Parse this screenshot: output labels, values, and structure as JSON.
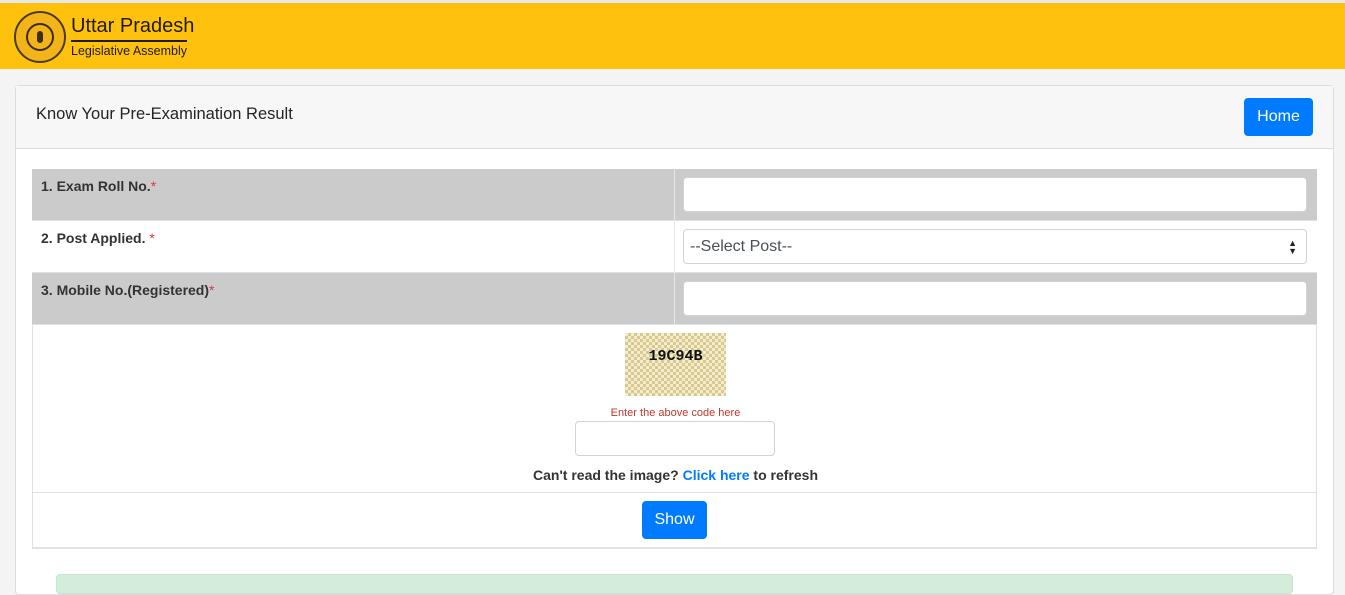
{
  "header": {
    "brand_title": "Uttar Pradesh",
    "brand_subtitle": "Legislative Assembly",
    "logo_icon": "emblem-icon",
    "background_color": "#fec20e"
  },
  "card": {
    "title": "Know Your Pre-Examination Result",
    "home_label": "Home"
  },
  "form": {
    "fields": [
      {
        "label": "1. Exam Roll No.",
        "required_mark": "*",
        "value": ""
      },
      {
        "label": "2. Post Applied. ",
        "required_mark": "*",
        "selected": "--Select Post--"
      },
      {
        "label": "3. Mobile No.(Registered)",
        "required_mark": "*",
        "value": ""
      }
    ]
  },
  "captcha": {
    "code": "19C94B",
    "hint": "Enter the above code here",
    "input_value": "",
    "refresh_prefix": "Can't read the image? ",
    "refresh_link": "Click here",
    "refresh_suffix": " to refresh"
  },
  "actions": {
    "show_label": "Show"
  },
  "colors": {
    "primary": "#007bff",
    "required": "#dc3545"
  }
}
